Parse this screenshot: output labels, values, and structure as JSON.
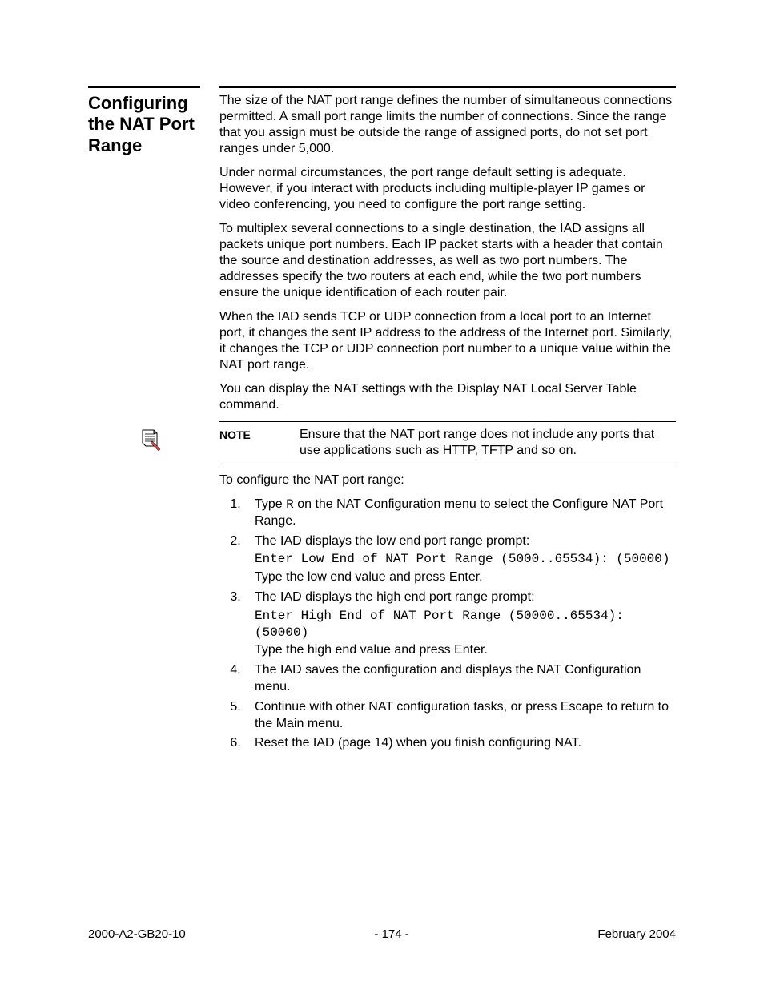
{
  "heading": "Configuring the NAT Port Range",
  "paragraphs": {
    "p1": "The size of the NAT port range defines the number of simultaneous connections permitted. A small port range limits the number of connections. Since the range that you assign must be outside the range of assigned ports, do not set port ranges under 5,000.",
    "p2": "Under normal circumstances, the port range default setting is adequate. However, if you interact with products including multiple-player IP games or video conferencing, you need to configure the port range setting.",
    "p3": "To multiplex several connections to a single destination, the IAD assigns all packets unique port numbers. Each IP packet starts with a header that contain the source and destination addresses, as well as two port numbers. The addresses specify the two routers at each end, while the two port numbers ensure the unique identification of each router pair.",
    "p4": "When the IAD sends TCP or UDP connection from a local port to an Internet port, it changes the sent IP address to the address of the Internet port. Similarly, it changes the TCP or UDP connection port number to a unique value within the NAT port range.",
    "p5": "You can display the NAT settings with the Display NAT Local Server Table command."
  },
  "note": {
    "label": "NOTE",
    "text": "Ensure that the NAT port range does not include any ports that use applications such as HTTP, TFTP and so on."
  },
  "instructions_intro": "To configure the NAT port range:",
  "steps": {
    "s1a": "Type ",
    "s1key": "R",
    "s1b": " on the NAT Configuration menu to select the Configure NAT Port Range.",
    "s2a": "The IAD displays the low end port range prompt:",
    "s2cmd": "Enter Low End of NAT Port Range (5000..65534): (50000)",
    "s2b": "Type the low end value and press Enter.",
    "s3a": "The IAD displays the high end port range prompt:",
    "s3cmd": "Enter High End of NAT Port Range (50000..65534): (50000)",
    "s3b": "Type the high end value and press Enter.",
    "s4": "The IAD saves the configuration and displays the NAT Configuration menu.",
    "s5": "Continue with other NAT configuration tasks, or press Escape to return to the Main menu.",
    "s6": "Reset the IAD (page 14) when you finish configuring NAT."
  },
  "footer": {
    "left": "2000-A2-GB20-10",
    "center": "- 174 -",
    "right": "February 2004"
  }
}
